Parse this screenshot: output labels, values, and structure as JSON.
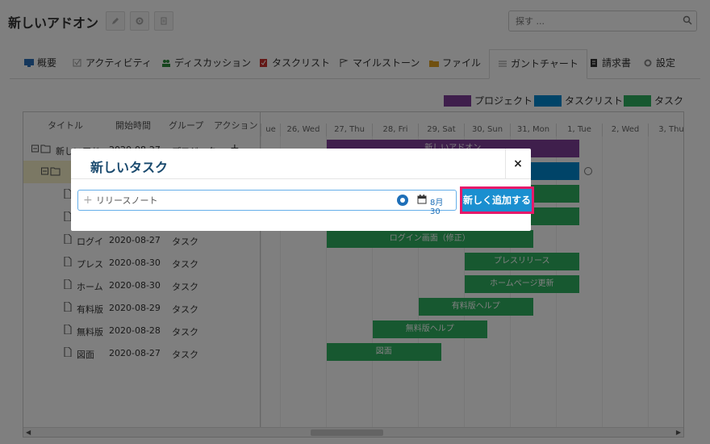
{
  "header": {
    "title": "新しいアドオン",
    "search_placeholder": "探す ...",
    "icons": [
      "pencil-icon",
      "gear-icon",
      "document-icon"
    ]
  },
  "tabs": [
    {
      "label": "概要",
      "icon": "monitor-icon"
    },
    {
      "label": "アクティビティ",
      "icon": "checkbox-icon"
    },
    {
      "label": "ディスカッション",
      "icon": "people-icon"
    },
    {
      "label": "タスクリスト",
      "icon": "checklist-icon"
    },
    {
      "label": "マイルストーン",
      "icon": "flag-icon"
    },
    {
      "label": "ファイル",
      "icon": "folder-icon"
    },
    {
      "label": "ガントチャート",
      "icon": "lines-icon"
    },
    {
      "label": "請求書",
      "icon": "invoice-icon"
    },
    {
      "label": "設定",
      "icon": "gear-icon"
    }
  ],
  "legend": [
    {
      "label": "プロジェクト",
      "color": "#7f3f98"
    },
    {
      "label": "タスクリスト",
      "color": "#0089d0"
    },
    {
      "label": "タスク",
      "color": "#2eb060"
    }
  ],
  "gantt": {
    "columns": {
      "title": "タイトル",
      "start": "開始時間",
      "group": "グループ",
      "action": "アクション"
    },
    "days": [
      "ue",
      "26, Wed",
      "27, Thu",
      "28, Fri",
      "29, Sat",
      "30, Sun",
      "31, Mon",
      "1, Tue",
      "2, Wed",
      "3, Thu"
    ],
    "rows": [
      {
        "title": "新しいアド",
        "start": "2020-08-27",
        "group": "プロジェク",
        "kind": "project"
      },
      {
        "title": "",
        "start": "",
        "group": "",
        "kind": "list"
      },
      {
        "title": "",
        "start": "",
        "group": "",
        "kind": "task"
      },
      {
        "title": "",
        "start": "",
        "group": "",
        "kind": "task"
      },
      {
        "title": "ログイ",
        "start": "2020-08-27",
        "group": "タスク",
        "kind": "task"
      },
      {
        "title": "プレス",
        "start": "2020-08-30",
        "group": "タスク",
        "kind": "task"
      },
      {
        "title": "ホーム",
        "start": "2020-08-30",
        "group": "タスク",
        "kind": "task"
      },
      {
        "title": "有料版",
        "start": "2020-08-29",
        "group": "タスク",
        "kind": "task"
      },
      {
        "title": "無料版",
        "start": "2020-08-28",
        "group": "タスク",
        "kind": "task"
      },
      {
        "title": "図面",
        "start": "2020-08-27",
        "group": "タスク",
        "kind": "task"
      }
    ],
    "bars": [
      {
        "label": "新しいアドオン",
        "kind": "proj",
        "start_day": "27, Thu",
        "end_day": "1, Tue"
      },
      {
        "label": "",
        "kind": "list",
        "start_day": "27, Thu",
        "end_day": "1, Tue"
      },
      {
        "label": "",
        "kind": "task",
        "start_day": "27, Thu",
        "end_day": "1, Tue"
      },
      {
        "label": "",
        "kind": "task",
        "start_day": "27, Thu",
        "end_day": "1, Tue"
      },
      {
        "label": "ログイン画面（修正）",
        "kind": "task",
        "start_day": "27, Thu",
        "end_day": "31, Mon"
      },
      {
        "label": "プレスリリース",
        "kind": "task",
        "start_day": "30, Sun",
        "end_day": "1, Tue"
      },
      {
        "label": "ホームページ更新",
        "kind": "task",
        "start_day": "30, Sun",
        "end_day": "1, Tue"
      },
      {
        "label": "有料版ヘルプ",
        "kind": "task",
        "start_day": "29, Sat",
        "end_day": "31, Mon"
      },
      {
        "label": "無料版ヘルプ",
        "kind": "task",
        "start_day": "28, Fri",
        "end_day": "30, Sun"
      },
      {
        "label": "図面",
        "kind": "task",
        "start_day": "27, Thu",
        "end_day": "29, Sat"
      }
    ]
  },
  "modal": {
    "title": "新しいタスク",
    "close_label": "×",
    "input_value": "リリースノート",
    "date_label": "8月 30",
    "add_button_label": "新しく追加する",
    "highlight_color": "#e6196a"
  }
}
